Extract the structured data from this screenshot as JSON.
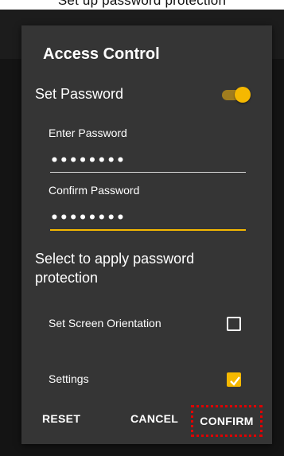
{
  "caption": "Set up password protection",
  "dialog": {
    "title": "Access Control",
    "set_password_label": "Set Password",
    "set_password_on": true,
    "enter_password": {
      "label": "Enter Password",
      "value": "••••••••"
    },
    "confirm_password": {
      "label": "Confirm Password",
      "value": "••••••••"
    },
    "select_heading": "Select to apply password protection",
    "options": [
      {
        "label": "Set Screen Orientation",
        "checked": false
      },
      {
        "label": "Settings",
        "checked": true
      }
    ],
    "buttons": {
      "reset": "RESET",
      "cancel": "CANCEL",
      "confirm": "CONFIRM"
    }
  },
  "colors": {
    "accent": "#f5b800",
    "dialog_bg": "#353535",
    "highlight": "#e00000"
  }
}
